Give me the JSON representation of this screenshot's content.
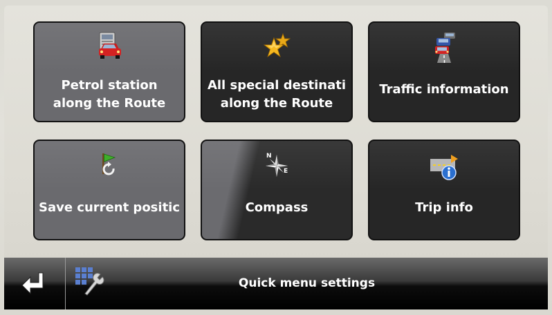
{
  "tiles": [
    {
      "line1": "Petrol station",
      "line2": "along the Route",
      "icon": "petrol-car-icon"
    },
    {
      "line1": "All special destinati",
      "line2": "along the Route",
      "icon": "stars-icon"
    },
    {
      "label": "Traffic information",
      "icon": "traffic-cars-icon"
    },
    {
      "label": "Save current positic",
      "icon": "flag-save-icon"
    },
    {
      "label": "Compass",
      "icon": "compass-icon"
    },
    {
      "label": "Trip info",
      "icon": "trip-info-icon"
    }
  ],
  "bottom_bar": {
    "back_icon": "return-arrow-icon",
    "settings_icon": "grid-wrench-icon",
    "settings_label": "Quick menu settings"
  },
  "colors": {
    "tile_dark": "#262626",
    "tile_grey": "#6a6a6e",
    "background": "#e0dfd8",
    "star": "#f5b820",
    "info_blue": "#2a6fd0"
  }
}
